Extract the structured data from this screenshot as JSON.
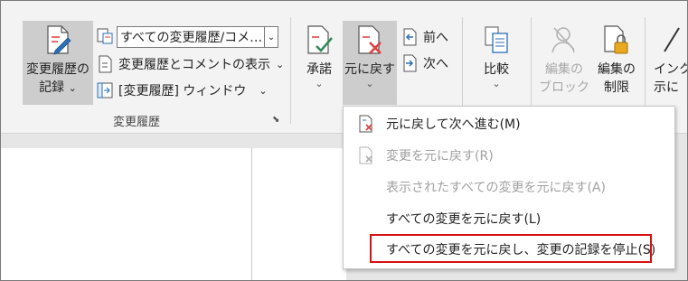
{
  "ribbon": {
    "group_label": "変更履歴",
    "track_changes": {
      "label_line1": "変更履歴の",
      "label_line2": "記録",
      "chev": "⌄"
    },
    "markup_dropdown": {
      "value": "すべての変更履歴/コメ…",
      "arrow": "⌄"
    },
    "show_markup": {
      "label": "変更履歴とコメントの表示",
      "chev": "⌄"
    },
    "reviewing_pane": {
      "label": "[変更履歴] ウィンドウ",
      "chev": "⌄"
    },
    "accept": {
      "label": "承諾",
      "chev": "⌄"
    },
    "reject": {
      "label": "元に戻す",
      "chev": "⌄"
    },
    "previous": {
      "label": "前へ"
    },
    "next": {
      "label": "次へ"
    },
    "compare": {
      "label": "比較",
      "chev": "⌄"
    },
    "block_authors": {
      "label_line1": "編集の",
      "label_line2": "ブロック",
      "chev": "⌄"
    },
    "restrict_editing": {
      "label_line1": "編集の",
      "label_line2": "制限"
    },
    "ink": {
      "label_line1": "インク",
      "label_line2": "示に"
    }
  },
  "menu": {
    "items": [
      {
        "label": "元に戻して次へ進む(M)",
        "enabled": true
      },
      {
        "label": "変更を元に戻す(R)",
        "enabled": false
      },
      {
        "label": "表示されたすべての変更を元に戻す(A)",
        "enabled": false
      },
      {
        "label": "すべての変更を元に戻す(L)",
        "enabled": true
      },
      {
        "label": "すべての変更を元に戻し、変更の記録を停止(S)",
        "enabled": true
      }
    ]
  },
  "colors": {
    "highlight_border": "#d80f0f",
    "accent_red": "#e03c3c",
    "accent_blue": "#2b6fba",
    "accent_green": "#2e8b57",
    "lock_yellow": "#e8a820"
  }
}
